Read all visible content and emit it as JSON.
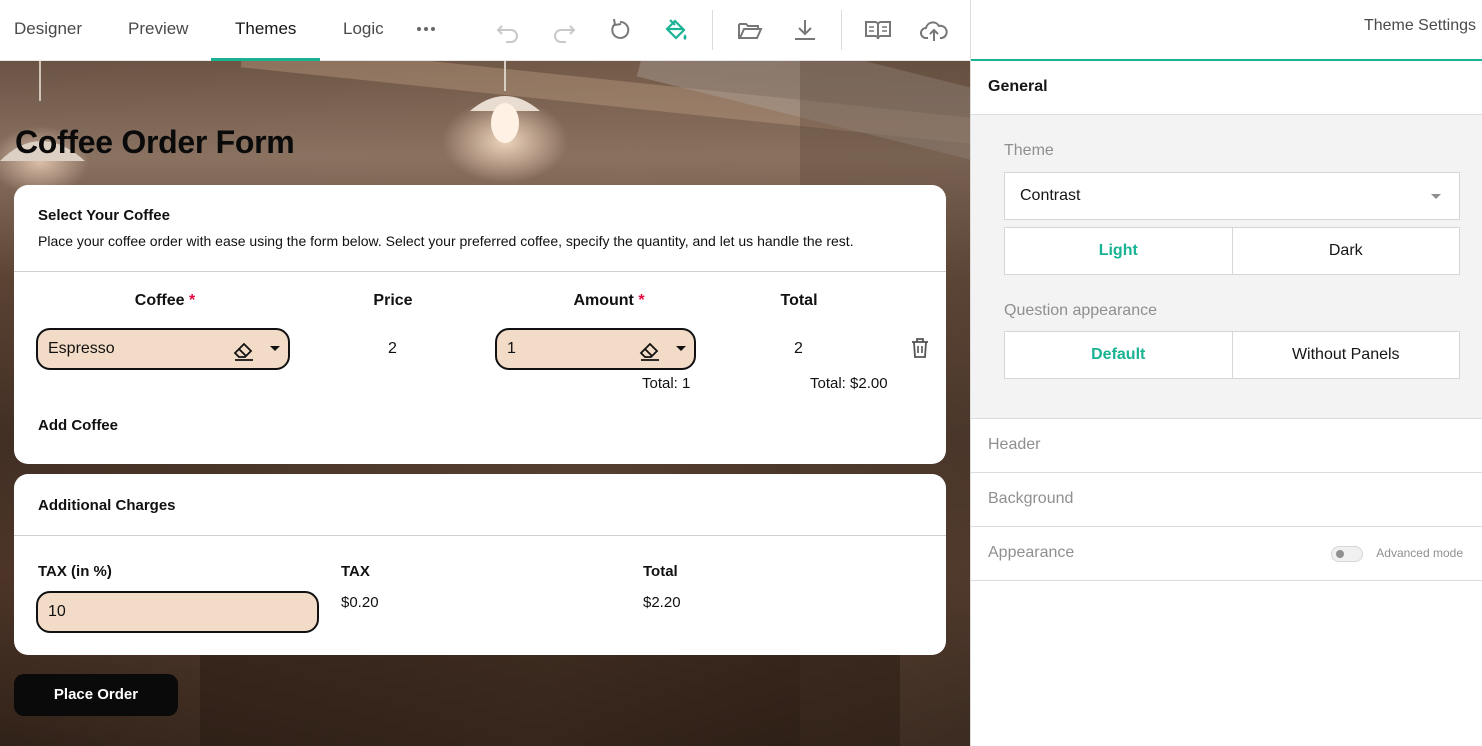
{
  "toolbar": {
    "tabs": [
      "Designer",
      "Preview",
      "Themes",
      "Logic"
    ],
    "active_tab": "Themes",
    "more_icon": "more-dots-icon",
    "icons": [
      "undo-icon",
      "redo-icon",
      "reset-icon",
      "paint-bucket-icon",
      "open-folder-icon",
      "download-icon",
      "book-icon",
      "cloud-upload-icon"
    ],
    "accent_color": "#19b394"
  },
  "form": {
    "title": "Coffee Order Form",
    "panel1": {
      "title": "Select Your Coffee",
      "description": "Place your coffee order with ease using the form below. Select your preferred coffee, specify the quantity, and let us handle the rest.",
      "columns": [
        "Coffee",
        "Price",
        "Amount",
        "Total"
      ],
      "required_mark": "*",
      "row": {
        "coffee": "Espresso",
        "price": "2",
        "amount": "1",
        "total": "2"
      },
      "footer": {
        "amount_total": "Total: 1",
        "total_total": "Total: $2.00"
      },
      "add_label": "Add Coffee"
    },
    "panel2": {
      "title": "Additional Charges",
      "tax_label": "TAX (in %)",
      "tax_value": "10",
      "tax_amount_label": "TAX",
      "tax_amount_value": "$0.20",
      "total_label": "Total",
      "total_value": "$2.20"
    },
    "submit_label": "Place Order",
    "input_bg_color": "#f3dcc7"
  },
  "settings": {
    "title": "Theme Settings",
    "sections": {
      "general": "General",
      "header": "Header",
      "background": "Background",
      "appearance": "Appearance"
    },
    "theme_label": "Theme",
    "theme_value": "Contrast",
    "mode_options": [
      "Light",
      "Dark"
    ],
    "mode_selected": "Light",
    "question_appearance_label": "Question appearance",
    "question_appearance_options": [
      "Default",
      "Without Panels"
    ],
    "question_appearance_selected": "Default",
    "advanced_mode_label": "Advanced mode",
    "advanced_mode_on": false
  }
}
